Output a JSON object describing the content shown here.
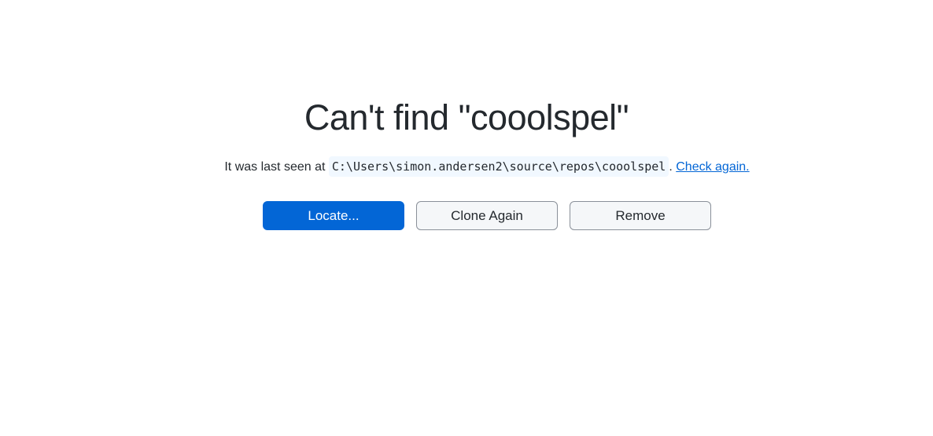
{
  "title": "Can't find \"cooolspel\"",
  "message": {
    "prefix": "It was last seen at",
    "path": "C:\\Users\\simon.andersen2\\source\\repos\\cooolspel",
    "separator": ".",
    "check_again_link": "Check again."
  },
  "buttons": {
    "locate": "Locate...",
    "clone_again": "Clone Again",
    "remove": "Remove"
  },
  "colors": {
    "primary": "#0366d6",
    "text": "#24292e",
    "path_background": "#f1f8ff"
  }
}
